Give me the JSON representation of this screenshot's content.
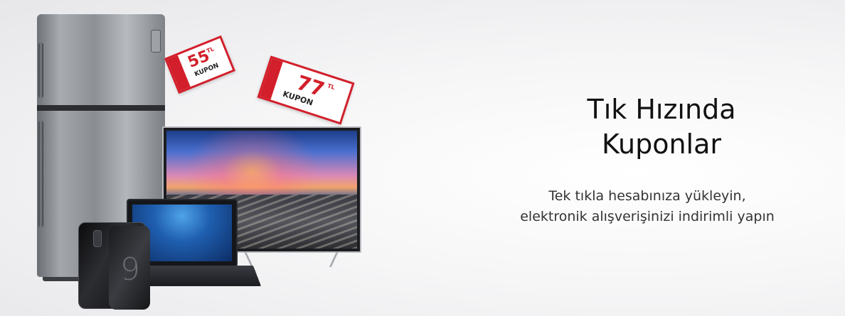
{
  "banner": {
    "headline_line1": "Tık Hızında",
    "headline_line2": "Kuponlar",
    "subtext_line1": "Tek tıkla hesabınıza yükleyin,",
    "subtext_line2": "elektronik alışverişinizi indirimli yapın"
  },
  "coupons": [
    {
      "amount": "55",
      "currency": "TL",
      "label": "KUPON"
    },
    {
      "amount": "77",
      "currency": "TL",
      "label": "KUPON"
    }
  ],
  "products": {
    "phone_model": "9"
  },
  "colors": {
    "coupon_red": "#d21f2b",
    "text_dark": "#111111"
  }
}
